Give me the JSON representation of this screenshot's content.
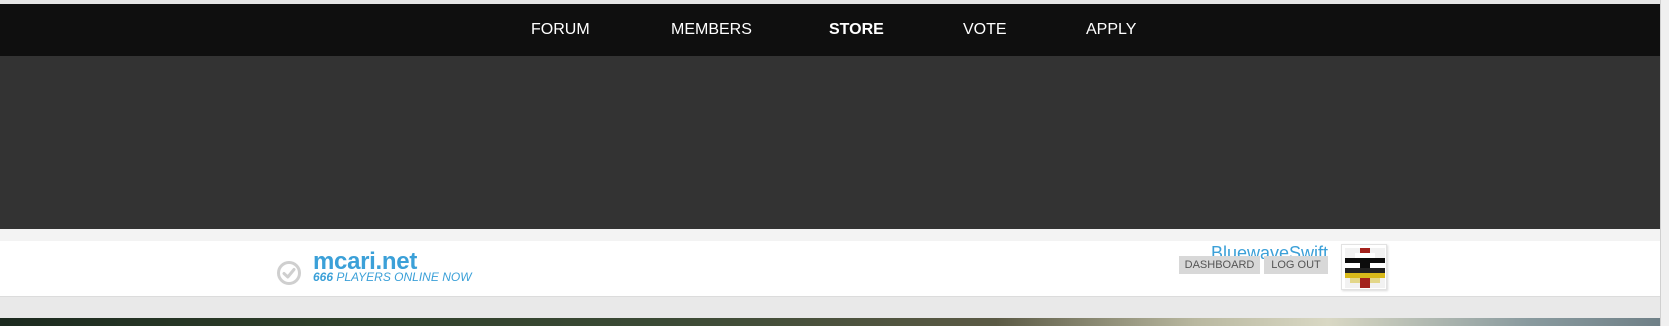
{
  "nav": {
    "items": [
      {
        "label": "FORUM",
        "active": false
      },
      {
        "label": "MEMBERS",
        "active": false
      },
      {
        "label": "STORE",
        "active": true
      },
      {
        "label": "VOTE",
        "active": false
      },
      {
        "label": "APPLY",
        "active": false
      }
    ]
  },
  "server": {
    "name": "mcari.net",
    "player_count": "666",
    "players_text": "PLAYERS ONLINE NOW",
    "status_icon": "check-circle-icon"
  },
  "user": {
    "name": "BluewaveSwift",
    "dashboard_label": "DASHBOARD",
    "logout_label": "LOG OUT"
  },
  "colors": {
    "navbar": "#0f0f0f",
    "banner": "#333333",
    "accent": "#3ba0d8"
  }
}
